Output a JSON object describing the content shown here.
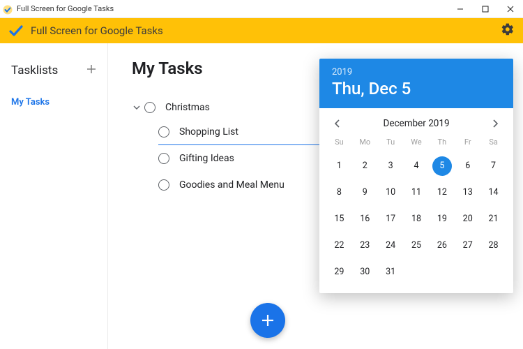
{
  "window": {
    "title": "Full Screen for Google Tasks"
  },
  "toolbar": {
    "title": "Full Screen for Google Tasks"
  },
  "sidebar": {
    "heading": "Tasklists",
    "items": [
      {
        "label": "My Tasks"
      }
    ]
  },
  "main": {
    "heading": "My Tasks",
    "tasks": [
      {
        "label": "Christmas",
        "subtasks": [
          {
            "label": "Shopping List"
          },
          {
            "label": "Gifting Ideas"
          },
          {
            "label": "Goodies and Meal Menu"
          }
        ]
      }
    ]
  },
  "datepicker": {
    "year": "2019",
    "date_display": "Thu, Dec 5",
    "month_label": "December 2019",
    "dows": [
      "Su",
      "Mo",
      "Tu",
      "We",
      "Th",
      "Fr",
      "Sa"
    ],
    "selected_day": 5,
    "first_dow": 0,
    "days_in_month": 31
  },
  "colors": {
    "accent_blue": "#1a73e8",
    "toolbar_yellow": "#ffc107",
    "dp_header_blue": "#1e88e5"
  }
}
